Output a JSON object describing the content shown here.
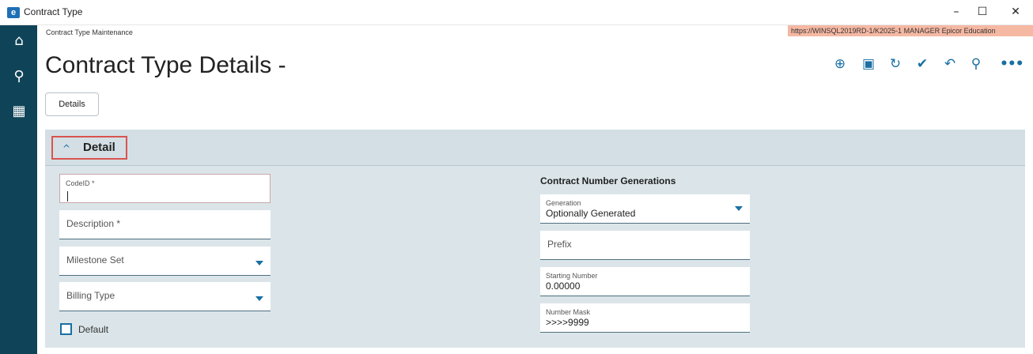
{
  "window": {
    "title": "Contract Type",
    "logo_letter": "e",
    "minimize": "–",
    "maximize": "☐",
    "close": "✕"
  },
  "rail": {
    "items": [
      {
        "icon": "home-icon",
        "glyph": "⌂"
      },
      {
        "icon": "search-icon",
        "glyph": "⚲"
      },
      {
        "icon": "apps-grid-icon",
        "glyph": "▦"
      }
    ]
  },
  "header": {
    "breadcrumb": "Contract Type Maintenance",
    "environment": "https://WINSQL2019RD-1/K2025-1  MANAGER  Epicor Education",
    "page_title": "Contract Type Details -"
  },
  "toolbar": {
    "items": [
      {
        "name": "add-new-icon",
        "glyph": "⊕"
      },
      {
        "name": "save-icon",
        "glyph": "▣"
      },
      {
        "name": "refresh-icon",
        "glyph": "↻"
      },
      {
        "name": "clear-icon",
        "glyph": "✔"
      },
      {
        "name": "undo-icon",
        "glyph": "↶"
      },
      {
        "name": "search-icon",
        "glyph": "⚲"
      },
      {
        "name": "more-icon",
        "glyph": "•••"
      }
    ]
  },
  "tabs": {
    "details_label": "Details"
  },
  "detail": {
    "section_title": "Detail",
    "chevron": "^",
    "left": {
      "code_id_label": "CodeID *",
      "code_id_value": "",
      "description_label": "Description *",
      "milestone_set_label": "Milestone Set",
      "billing_type_label": "Billing Type",
      "default_label": "Default",
      "default_checked": false
    },
    "right": {
      "group_title": "Contract Number Generations",
      "generation_label": "Generation",
      "generation_value": "Optionally Generated",
      "prefix_label": "Prefix",
      "starting_number_label": "Starting Number",
      "starting_number_value": "0.00000",
      "number_mask_label": "Number Mask",
      "number_mask_value": ">>>>9999"
    }
  },
  "colors": {
    "rail": "#0f4458",
    "accent": "#1a6fa3",
    "panel": "#dbe5e9",
    "environment_badge": "#f5b8a3",
    "focus_outline": "#d9534f"
  }
}
